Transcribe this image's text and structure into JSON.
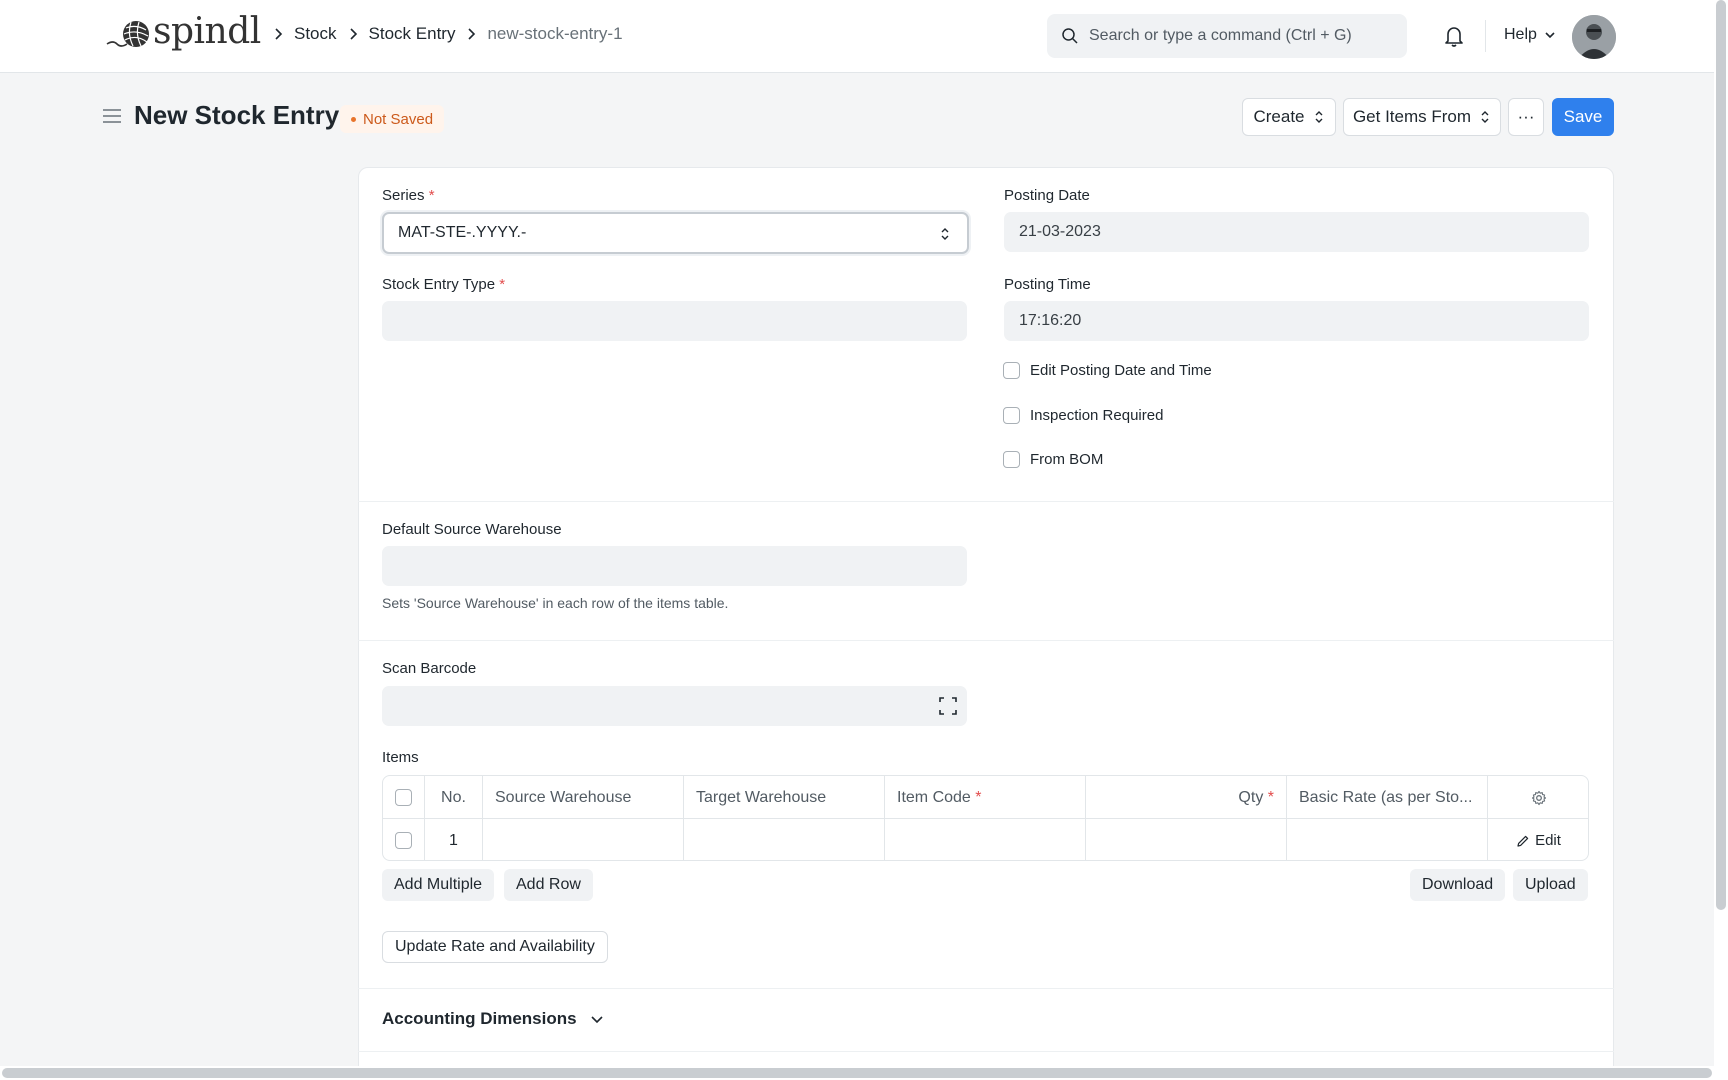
{
  "app": {
    "logo_text": "spindl"
  },
  "breadcrumbs": [
    {
      "label": "Stock"
    },
    {
      "label": "Stock Entry"
    },
    {
      "label": "new-stock-entry-1"
    }
  ],
  "search": {
    "placeholder": "Search or type a command (Ctrl + G)"
  },
  "nav": {
    "help_label": "Help"
  },
  "page": {
    "title": "New Stock Entry",
    "status": "Not Saved",
    "status_color": "#cc5a1b"
  },
  "actions": {
    "create_label": "Create",
    "get_items_label": "Get Items From",
    "more_label": "···",
    "save_label": "Save",
    "save_color": "#2f80ed"
  },
  "form": {
    "series": {
      "label": "Series",
      "required": "*",
      "value": "MAT-STE-.YYYY.-"
    },
    "posting_date": {
      "label": "Posting Date",
      "value": "21-03-2023"
    },
    "stock_entry_type": {
      "label": "Stock Entry Type",
      "required": "*",
      "value": ""
    },
    "posting_time": {
      "label": "Posting Time",
      "value": "17:16:20"
    },
    "checkboxes": [
      {
        "label": "Edit Posting Date and Time",
        "checked": false
      },
      {
        "label": "Inspection Required",
        "checked": false
      },
      {
        "label": "From BOM",
        "checked": false
      }
    ],
    "default_source_warehouse": {
      "label": "Default Source Warehouse",
      "value": "",
      "help": "Sets 'Source Warehouse' in each row of the items table."
    },
    "scan_barcode": {
      "label": "Scan Barcode",
      "value": ""
    },
    "items": {
      "label": "Items",
      "columns": [
        "No.",
        "Source Warehouse",
        "Target Warehouse",
        "Item Code",
        "Qty",
        "Basic Rate (as per Sto..."
      ],
      "required_mark": "*",
      "rows": [
        {
          "no": "1",
          "source_warehouse": "",
          "target_warehouse": "",
          "item_code": "",
          "qty": "",
          "basic_rate": "",
          "edit_label": "Edit"
        }
      ],
      "add_multiple_label": "Add Multiple",
      "add_row_label": "Add Row",
      "download_label": "Download",
      "upload_label": "Upload"
    },
    "update_rate_label": "Update Rate and Availability",
    "accounting_dimensions_label": "Accounting Dimensions"
  }
}
